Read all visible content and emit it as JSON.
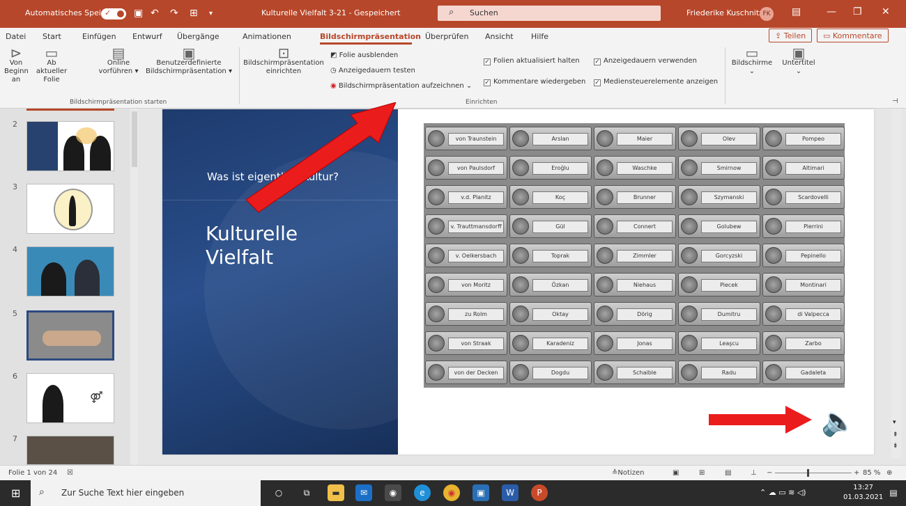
{
  "titlebar": {
    "autosave_label": "Automatisches Speichern",
    "document_title": "Kulturelle Vielfalt 3-21 - Gespeichert",
    "search_placeholder": "Suchen",
    "user_name": "Friederike Kuschnitzki",
    "user_initials": "FK"
  },
  "tabs": [
    "Datei",
    "Start",
    "Einfügen",
    "Entwurf",
    "Übergänge",
    "Animationen",
    "Bildschirmpräsentation",
    "Überprüfen",
    "Ansicht",
    "Hilfe"
  ],
  "active_tab": "Bildschirmpräsentation",
  "share_label": "Teilen",
  "comment_label": "Kommentare",
  "ribbon": {
    "from_start_1": "Von",
    "from_start_2": "Beginn an",
    "from_current_1": "Ab aktueller",
    "from_current_2": "Folie",
    "online_1": "Online",
    "online_2": "vorführen",
    "custom_1": "Benutzerdefinierte",
    "custom_2": "Bildschirmpräsentation",
    "group_start": "Bildschirmpräsentation starten",
    "setup_1": "Bildschirmpräsentation",
    "setup_2": "einrichten",
    "hide_slide": "Folie ausblenden",
    "rehearse": "Anzeigedauern testen",
    "record": "Bildschirmpräsentation aufzeichnen",
    "keep_updated": "Folien aktualisiert halten",
    "play_narrations": "Kommentare wiedergeben",
    "use_timings": "Anzeigedauern verwenden",
    "show_media": "Mediensteuerelemente anzeigen",
    "group_setup": "Einrichten",
    "monitors": "Bildschirme",
    "subtitles": "Untertitel"
  },
  "thumbnails": [
    "2",
    "3",
    "4",
    "5",
    "6",
    "7"
  ],
  "slide": {
    "subtitle": "Was ist eigentlich Kultur?",
    "title_line1": "Kulturelle",
    "title_line2": "Vielfalt"
  },
  "doorbell_names": [
    [
      "von Traunstein",
      "Arslan",
      "Maier",
      "Olev",
      "Pompeo"
    ],
    [
      "von Paulsdorf",
      "Eroğlu",
      "Waschke",
      "Smirnow",
      "Altimari"
    ],
    [
      "v.d. Planitz",
      "Koç",
      "Brunner",
      "Szymanski",
      "Scardovelli"
    ],
    [
      "v. Trauttmansdorff",
      "Gül",
      "Connert",
      "Golubew",
      "Pierrini"
    ],
    [
      "v. Oelkersbach",
      "Toprak",
      "Zimmler",
      "Gorcyzski",
      "Pepinello"
    ],
    [
      "von Moritz",
      "Özkan",
      "Niehaus",
      "Piecek",
      "Montinari"
    ],
    [
      "zu Rolm",
      "Oktay",
      "Dörig",
      "Dumitru",
      "di Valpecca"
    ],
    [
      "von Straak",
      "Karadeniz",
      "Jonas",
      "Leaşcu",
      "Zarbo"
    ],
    [
      "von der Decken",
      "Dogdu",
      "Schaible",
      "Radu",
      "Gadaleta"
    ]
  ],
  "status": {
    "slide_counter": "Folie 1 von 24",
    "notes": "Notizen",
    "zoom": "85 %"
  },
  "taskbar": {
    "search_placeholder": "Zur Suche Text hier eingeben",
    "time": "13:27",
    "date": "01.03.2021"
  },
  "colors": {
    "accent": "#b7472a",
    "arrow": "#ea1c1c",
    "slide_blue": "#1e3b6d"
  }
}
